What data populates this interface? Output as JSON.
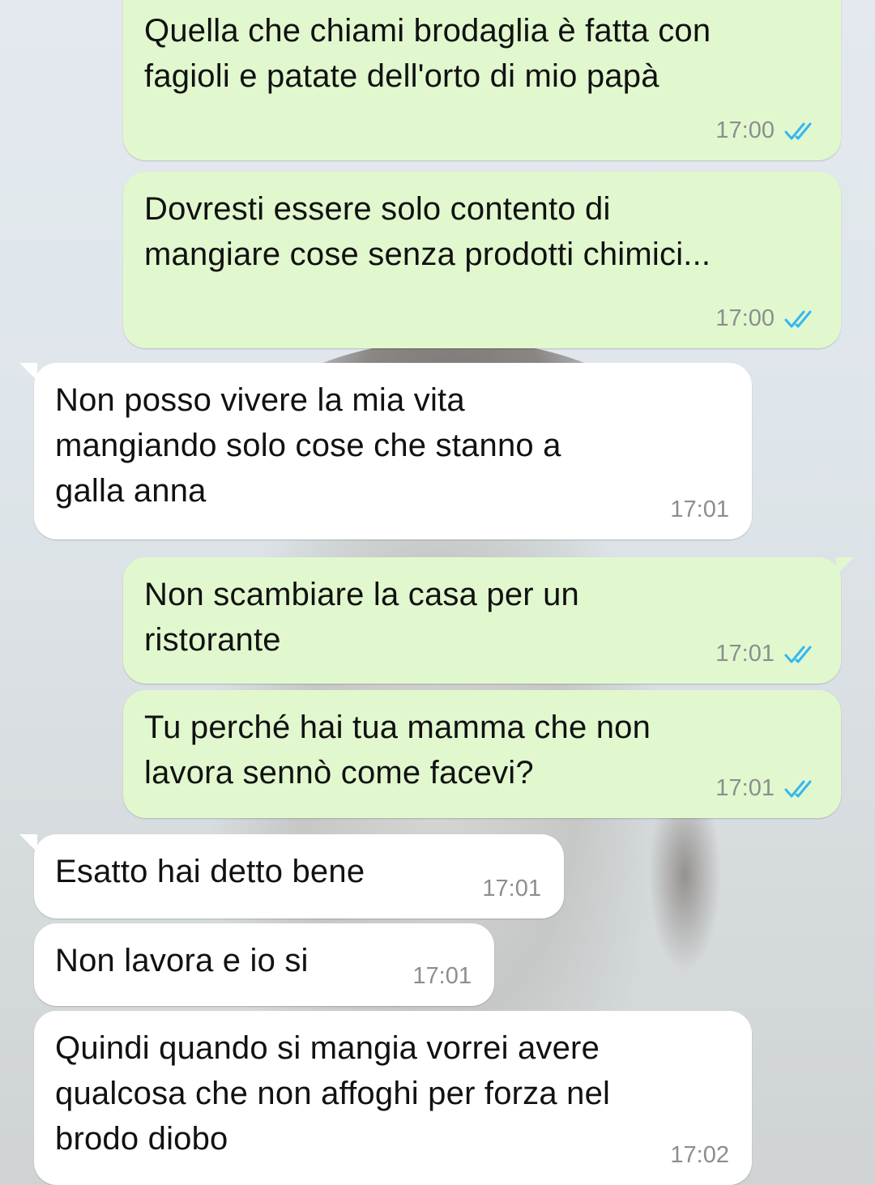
{
  "colors": {
    "outgoing_bubble": "#e1f8cf",
    "incoming_bubble": "#ffffff",
    "read_ticks": "#34b7f1",
    "timestamp": "#8a8f8c"
  },
  "messages": [
    {
      "direction": "outgoing",
      "text": "Quella che chiami brodaglia è fatta con\nfagioli e patate dell'orto di mio papà",
      "time": "17:00",
      "status_icon": "double-check-read-icon"
    },
    {
      "direction": "outgoing",
      "text": "Dovresti essere solo contento di\nmangiare cose senza prodotti chimici...",
      "time": "17:00",
      "status_icon": "double-check-read-icon"
    },
    {
      "direction": "incoming",
      "text": "Non posso vivere la mia vita\nmangiando solo cose che stanno a\ngalla anna",
      "time": "17:01"
    },
    {
      "direction": "outgoing",
      "text": "Non scambiare la casa per un\nristorante",
      "time": "17:01",
      "status_icon": "double-check-read-icon"
    },
    {
      "direction": "outgoing",
      "text": "Tu perché hai tua mamma che non\nlavora sennò come facevi?",
      "time": "17:01",
      "status_icon": "double-check-read-icon"
    },
    {
      "direction": "incoming",
      "text": "Esatto hai detto bene",
      "time": "17:01"
    },
    {
      "direction": "incoming",
      "text": "Non lavora e io si",
      "time": "17:01"
    },
    {
      "direction": "incoming",
      "text": "Quindi quando si mangia vorrei avere\nqualcosa che non affoghi per forza nel\nbrodo diobo",
      "time": "17:02"
    }
  ]
}
